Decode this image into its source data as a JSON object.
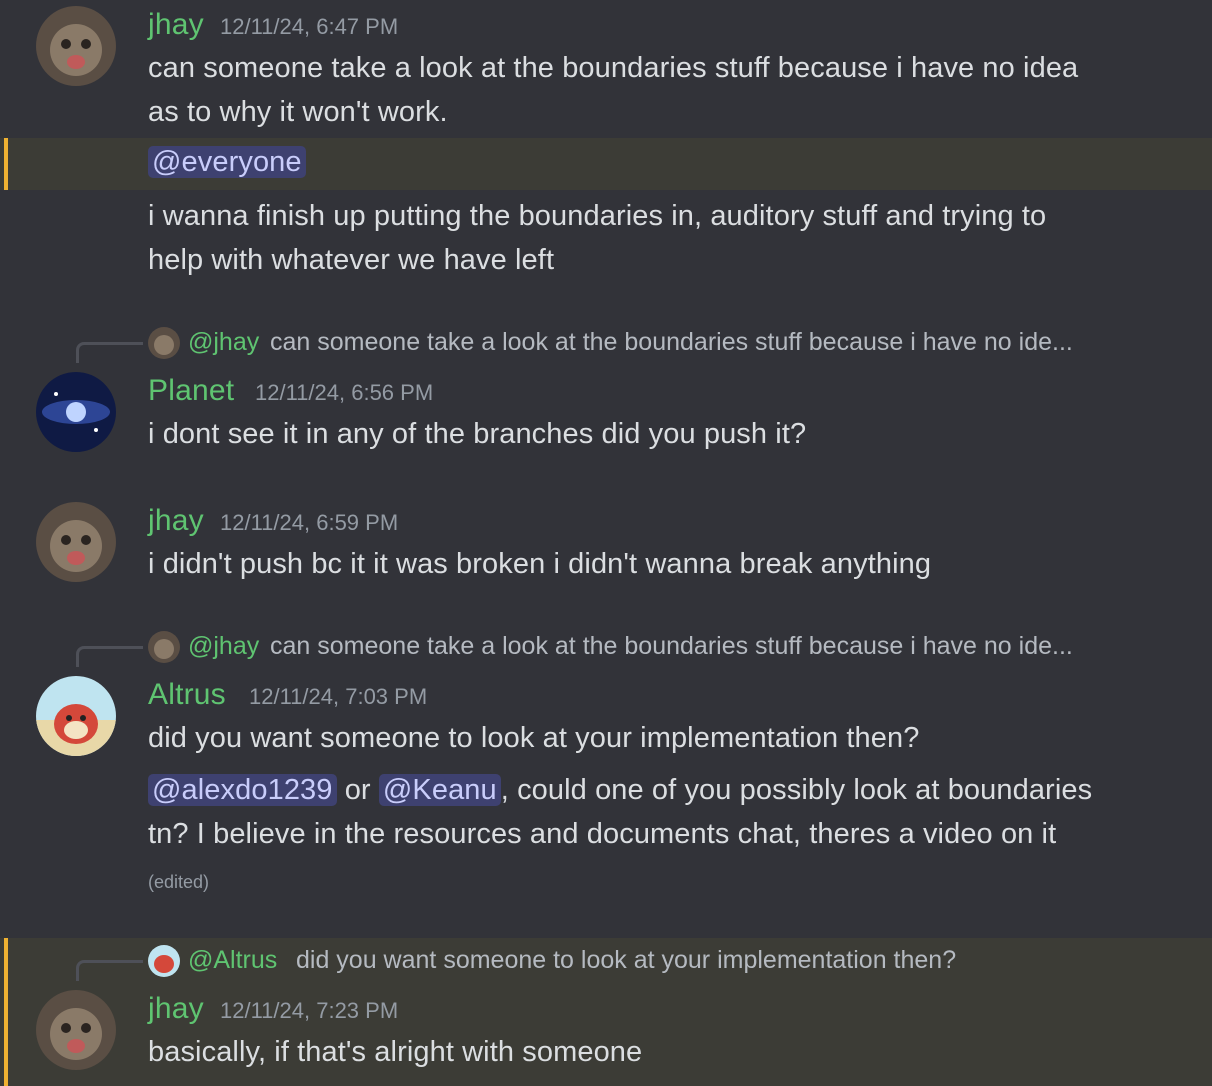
{
  "messages": [
    {
      "author": "jhay",
      "timestamp": "12/11/24, 6:47 PM",
      "lines": [
        "can someone take a look at the boundaries stuff because i have no idea",
        "as to why it won't work."
      ]
    },
    {
      "mention": "@everyone",
      "lines": [
        "i wanna finish up putting the boundaries in, auditory stuff and trying to",
        "help with whatever we have left"
      ]
    },
    {
      "reply": {
        "name": "@jhay",
        "text": "can someone take a look at the boundaries stuff because i have no ide..."
      },
      "author": "Planet",
      "timestamp": "12/11/24, 6:56 PM",
      "lines": [
        "i dont see it in any of the branches did you push it?"
      ]
    },
    {
      "author": "jhay",
      "timestamp": "12/11/24, 6:59 PM",
      "lines": [
        "i didn't push bc it it was broken i didn't wanna break anything"
      ]
    },
    {
      "reply": {
        "name": "@jhay",
        "text": "can someone take a look at the boundaries stuff because i have no ide..."
      },
      "author": "Altrus",
      "timestamp": "12/11/24, 7:03 PM",
      "lines": [
        "did you want someone to look at your implementation then?"
      ]
    },
    {
      "mention1": "@alexdo1239",
      "or": "or",
      "mention2": "@Keanu",
      "line1_rest": ", could one of you possibly look at boundaries",
      "line2": "tn? I believe in the resources and documents chat, theres a video on it",
      "edited": "(edited)"
    },
    {
      "reply": {
        "name": "@Altrus",
        "text": "did you want someone to look at your implementation then?"
      },
      "author": "jhay",
      "timestamp": "12/11/24, 7:23 PM",
      "lines": [
        "basically, if that's alright with someone"
      ]
    }
  ],
  "colors": {
    "background": "#323339",
    "highlight": "#3c3c36",
    "highlight_bar": "#f0b232",
    "author": "#5fc471",
    "mention_bg": "#3e4170",
    "mention_text": "#c9cdfb"
  }
}
